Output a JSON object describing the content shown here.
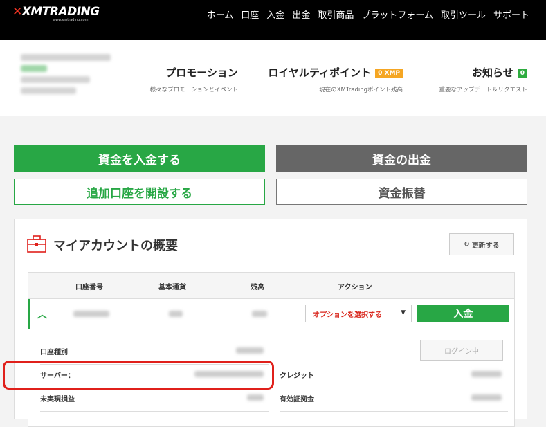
{
  "brand": {
    "logo": "XMTRADING",
    "logo_sub": "www.xmtrading.com"
  },
  "nav": [
    "ホーム",
    "口座",
    "入金",
    "出金",
    "取引商品",
    "プラットフォーム",
    "取引ツール",
    "サポート"
  ],
  "header": {
    "promotions": {
      "title": "プロモーション",
      "sub": "様々なプロモーションとイベント"
    },
    "loyalty": {
      "title": "ロイヤルティポイント",
      "badge": "0 XMP",
      "sub": "現在のXMTradingポイント残高"
    },
    "news": {
      "title": "お知らせ",
      "badge": "0",
      "sub": "重要なアップデート＆リクエスト"
    }
  },
  "actions": {
    "deposit": "資金を入金する",
    "withdraw": "資金の出金",
    "open_account": "追加口座を開設する",
    "transfer": "資金振替"
  },
  "overview": {
    "title": "マイアカウントの概要",
    "refresh": "更新する",
    "columns": [
      "口座番号",
      "基本通貨",
      "残高",
      "アクション"
    ],
    "row": {
      "option_select": "オプションを選択する",
      "deposit_btn": "入金"
    },
    "details": {
      "account_type": "口座種別",
      "login_btn": "ログイン中",
      "server": "サーバー：",
      "credit": "クレジット",
      "unrealized": "未実現損益",
      "margin": "有効証拠金"
    }
  },
  "colors": {
    "green": "#28a745",
    "red": "#e0201b",
    "orange": "#f5a623"
  }
}
